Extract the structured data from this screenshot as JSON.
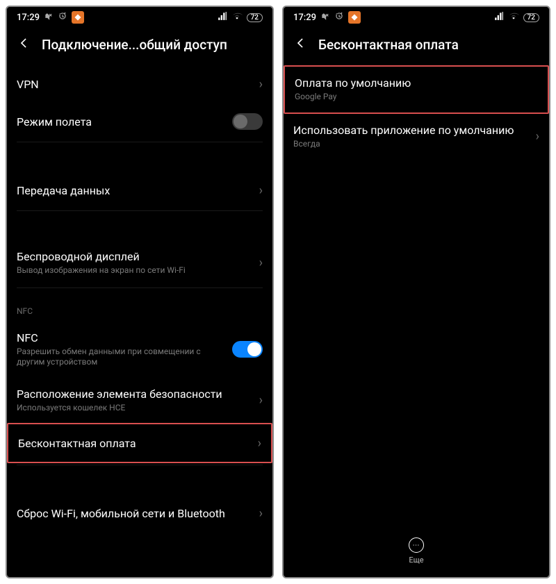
{
  "status": {
    "time": "17:29",
    "battery": "72"
  },
  "left": {
    "title": "Подключение...общий доступ",
    "items": {
      "vpn": "VPN",
      "airplane": "Режим полета",
      "data": "Передача данных",
      "cast": {
        "title": "Беспроводной дисплей",
        "sub": "Вывод изображения на экран по сети Wi-Fi"
      },
      "section": "NFC",
      "nfc": {
        "title": "NFC",
        "sub": "Разрешить обмен данными при совмещении с другим устройством"
      },
      "security": {
        "title": "Расположение элемента безопасности",
        "sub": "Используется кошелек HCE"
      },
      "contactless": "Бесконтактная оплата",
      "reset": "Сброс Wi-Fi, мобильной сети и Bluetooth"
    }
  },
  "right": {
    "title": "Бесконтактная оплата",
    "items": {
      "default": {
        "title": "Оплата по умолчанию",
        "sub": "Google Pay"
      },
      "use": {
        "title": "Использовать приложение по умолчанию",
        "sub": "Всегда"
      }
    },
    "more": "Еще"
  }
}
